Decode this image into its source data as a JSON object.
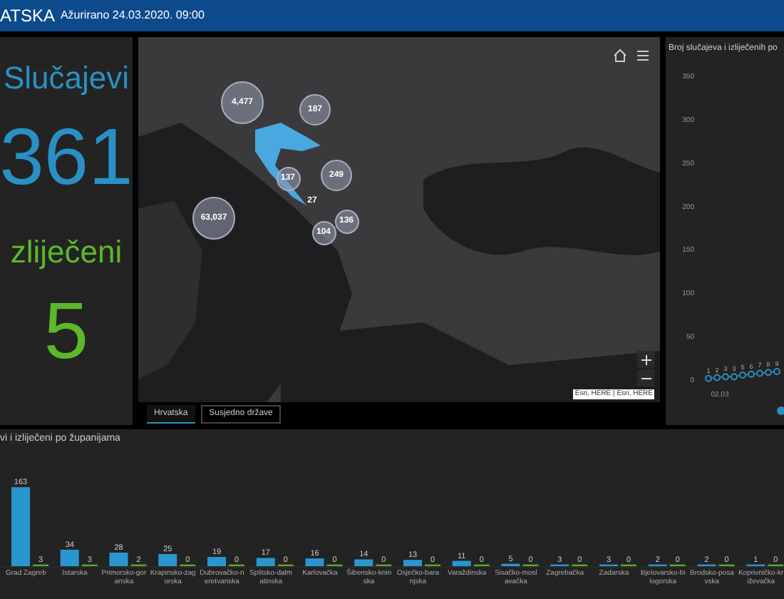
{
  "header": {
    "title": "ATSKA",
    "updated": "Ažurirano 24.03.2020. 09:00"
  },
  "stats": [
    {
      "kind": "cases",
      "label": "Slučajevi",
      "value": "361"
    },
    {
      "kind": "recovered",
      "label": "zliječeni",
      "value": "5"
    }
  ],
  "map": {
    "clusters": [
      {
        "label": "4,477"
      },
      {
        "label": "187"
      },
      {
        "label": "137"
      },
      {
        "label": "249"
      },
      {
        "label": "27"
      },
      {
        "label": "63,037"
      },
      {
        "label": "136"
      },
      {
        "label": "104"
      }
    ],
    "attribution": "Esri, HERE | Esri, HERE",
    "tabs": [
      {
        "label": "Hrvatska",
        "selected": true
      },
      {
        "label": "Susjedno države",
        "selected": false
      }
    ]
  },
  "daily_chart": {
    "chart_data": {
      "type": "line",
      "title": "Broj slučajeva i izliječenih po",
      "yticks": [
        0,
        50,
        100,
        150,
        200,
        250,
        300,
        350
      ],
      "ylim": [
        0,
        350
      ],
      "data_labels": true,
      "series": [
        {
          "color": "#2b8fc4",
          "marker": "circle",
          "values": [
            1,
            2,
            3,
            3,
            5,
            6,
            7,
            8,
            9
          ]
        }
      ]
    },
    "axis_date": "02.03"
  },
  "county_chart": {
    "chart_data": {
      "type": "bar",
      "title": "vi i izliječeni po županijama",
      "data_labels": true,
      "categories": [
        "Grad Zagreb",
        "Istarska",
        "Primorsko-goranska",
        "Krapinsko-zagorska",
        "Dubrovačko-neretvanska",
        "Splitsko-dalmatinska",
        "Karlovačka",
        "Šibensko-kninska",
        "Osječko-baranjska",
        "Varaždinska",
        "Sisačko-moslavačka",
        "Zagrebačka",
        "Zadarska",
        "Bjelovarsko-bilogorska",
        "Brodsko-posavska",
        "Koprivničko-križevačka"
      ],
      "series": [
        {
          "color": "#2a96cf",
          "values": [
            163,
            34,
            28,
            25,
            19,
            17,
            16,
            14,
            13,
            11,
            5,
            3,
            3,
            2,
            2,
            1
          ]
        },
        {
          "color": "#5aa82a",
          "values": [
            3,
            3,
            2,
            0,
            0,
            0,
            0,
            0,
            0,
            0,
            0,
            0,
            0,
            0,
            0,
            0
          ]
        }
      ]
    }
  }
}
